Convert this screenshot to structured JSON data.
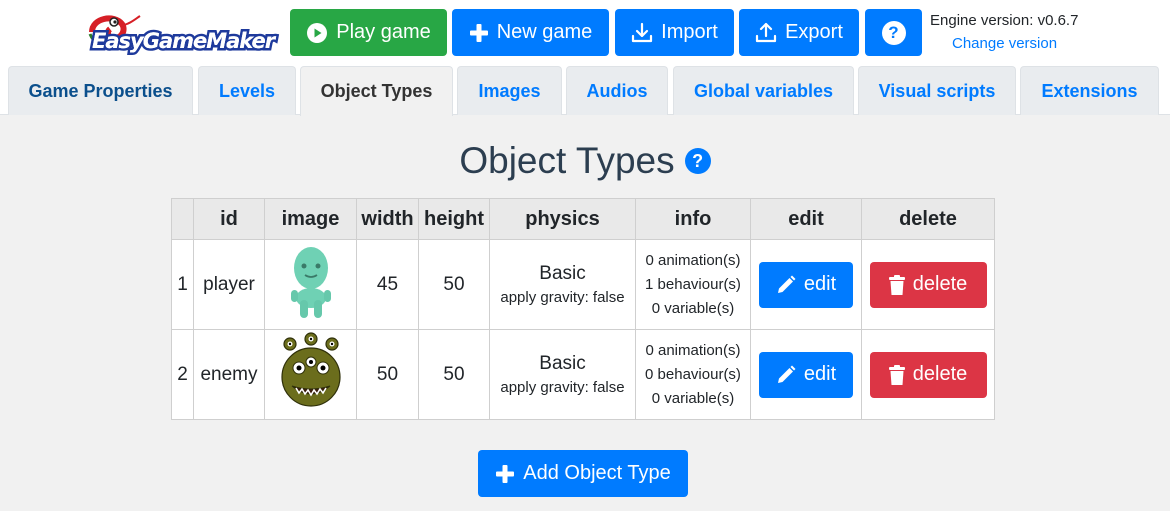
{
  "app": {
    "logo_text": "EasyGameMaker",
    "engine_version": "Engine version: v0.6.7",
    "change_version": "Change version"
  },
  "toolbar": {
    "play_label": "Play game",
    "new_label": "New game",
    "import_label": "Import",
    "export_label": "Export",
    "help_label": "?"
  },
  "tabs": [
    {
      "label": "Game Properties"
    },
    {
      "label": "Levels"
    },
    {
      "label": "Object Types",
      "active": true
    },
    {
      "label": "Images"
    },
    {
      "label": "Audios"
    },
    {
      "label": "Global variables"
    },
    {
      "label": "Visual scripts"
    },
    {
      "label": "Extensions"
    }
  ],
  "main": {
    "title": "Object Types",
    "help_label": "?",
    "table": {
      "headers": {
        "index": "",
        "id": "id",
        "image": "image",
        "width": "width",
        "height": "height",
        "physics": "physics",
        "info": "info",
        "edit": "edit",
        "delete": "delete"
      },
      "rows": [
        {
          "index": "1",
          "id": "player",
          "image_icon": "green-alien-sprite",
          "width": "45",
          "height": "50",
          "physics_type": "Basic",
          "physics_gravity": "apply gravity: false",
          "animations": "0 animation(s)",
          "behaviours": "1 behaviour(s)",
          "variables": "0 variable(s)",
          "edit_label": "edit",
          "delete_label": "delete"
        },
        {
          "index": "2",
          "id": "enemy",
          "image_icon": "olive-monster-sprite",
          "width": "50",
          "height": "50",
          "physics_type": "Basic",
          "physics_gravity": "apply gravity: false",
          "animations": "0 animation(s)",
          "behaviours": "0 behaviour(s)",
          "variables": "0 variable(s)",
          "edit_label": "edit",
          "delete_label": "delete"
        }
      ]
    },
    "add_label": "Add Object Type"
  },
  "colors": {
    "primary": "#007bff",
    "success": "#28a745",
    "danger": "#dc3545",
    "title": "#2c3e50",
    "page_bg": "#f1f1f1"
  }
}
